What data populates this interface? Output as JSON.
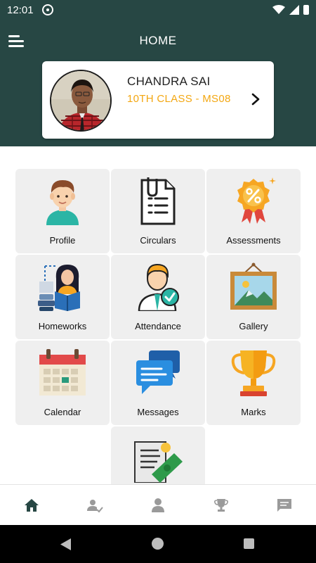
{
  "status_bar": {
    "time": "12:01",
    "app_icon": "at-sign-icon",
    "wifi_icon": "wifi-icon",
    "signal_icon": "signal-icon",
    "battery_icon": "battery-icon"
  },
  "header": {
    "title": "HOME",
    "menu_icon": "menu-icon",
    "background": "#274744"
  },
  "student": {
    "name": "CHANDRA SAI",
    "class_label": "10TH CLASS - MS08",
    "accent": "#f3a712",
    "chevron_icon": "chevron-right-icon"
  },
  "tiles": [
    {
      "label": "Profile",
      "icon": "profile-icon"
    },
    {
      "label": "Circulars",
      "icon": "circulars-icon"
    },
    {
      "label": "Assessments",
      "icon": "assessments-icon"
    },
    {
      "label": "Homeworks",
      "icon": "homeworks-icon"
    },
    {
      "label": "Attendance",
      "icon": "attendance-icon"
    },
    {
      "label": "Gallery",
      "icon": "gallery-icon"
    },
    {
      "label": "Calendar",
      "icon": "calendar-icon"
    },
    {
      "label": "Messages",
      "icon": "messages-icon"
    },
    {
      "label": "Marks",
      "icon": "marks-icon"
    },
    {
      "label": "",
      "icon": "fees-icon"
    }
  ],
  "bottom_nav": [
    {
      "icon": "home-icon",
      "active": true
    },
    {
      "icon": "attendance-check-icon",
      "active": false
    },
    {
      "icon": "person-icon",
      "active": false
    },
    {
      "icon": "trophy-icon",
      "active": false
    },
    {
      "icon": "chat-icon",
      "active": false
    }
  ],
  "system_nav": {
    "back_icon": "back-icon",
    "home_icon": "home-circle-icon",
    "recent_icon": "recent-apps-icon"
  }
}
